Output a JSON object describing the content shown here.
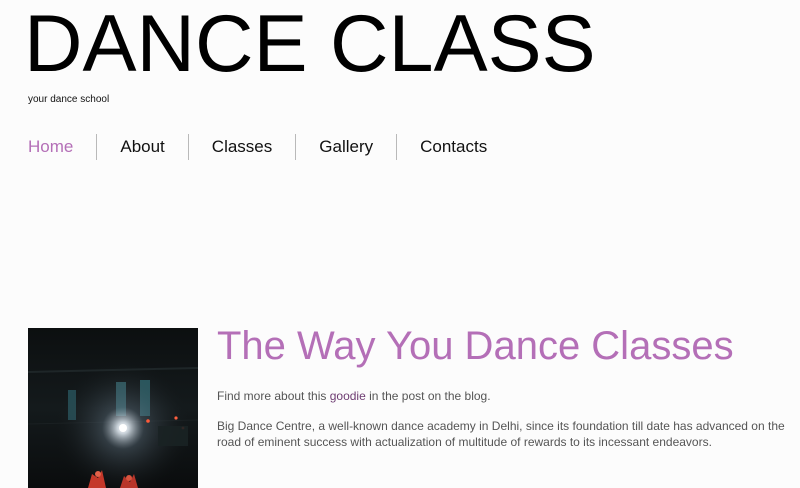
{
  "site": {
    "title": "DANCE CLASS",
    "tagline": "your dance school"
  },
  "nav": {
    "items": [
      {
        "label": "Home",
        "active": true
      },
      {
        "label": "About",
        "active": false
      },
      {
        "label": "Classes",
        "active": false
      },
      {
        "label": "Gallery",
        "active": false
      },
      {
        "label": "Contacts",
        "active": false
      }
    ]
  },
  "main": {
    "heading": "The Way You Dance Classes",
    "intro_before": "Find more about this ",
    "intro_link": "goodie",
    "intro_after": " in the post on the blog.",
    "description": "Big Dance Centre, a well-known dance academy in Delhi, since its foundation till date has advanced on the road of eminent success with actualization of multitude of rewards to its incessant endeavors."
  },
  "colors": {
    "accent": "#b46fb7",
    "link": "#6e3c72",
    "text": "#555555",
    "background": "#fcfcfc"
  }
}
